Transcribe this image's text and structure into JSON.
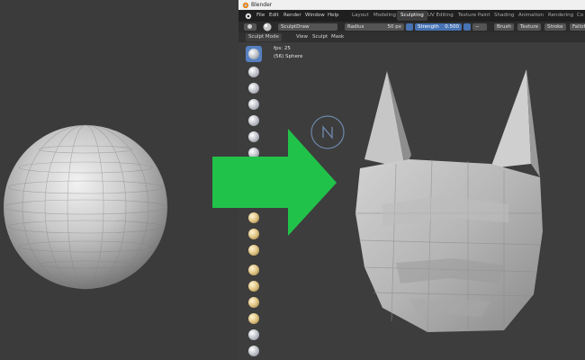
{
  "window": {
    "title": "Blender"
  },
  "menubar": {
    "menus": [
      "File",
      "Edit",
      "Render",
      "Window",
      "Help"
    ],
    "workspaces": [
      "Layout",
      "Modeling",
      "Sculpting",
      "UV Editing",
      "Texture Paint",
      "Shading",
      "Animation",
      "Rendering",
      "Co"
    ],
    "active_workspace": "Sculpting"
  },
  "tool_header": {
    "brush_name": "SculptDraw",
    "radius_label": "Radius",
    "radius_value": "50 px",
    "strength_label": "Strength",
    "strength_value": "0.500",
    "brush_menu": "Brush",
    "texture_menu": "Texture",
    "stroke_menu": "Stroke",
    "falloff_menu": "Falloff"
  },
  "viewport_header": {
    "mode": "Sculpt Mode",
    "menus": [
      "View",
      "Sculpt",
      "Mask"
    ]
  },
  "overlay": {
    "fps": "fps: 25",
    "object": "(56) Sphere"
  },
  "toolbar": {
    "tools": [
      "draw",
      "draw-sharp",
      "clay",
      "clay-strips",
      "layer",
      "inflate",
      "blob",
      "crease",
      "smooth",
      "flatten",
      "fill",
      "scrape",
      "pinch",
      "grab",
      "snake-hook",
      "thumb",
      "pose",
      "nudge",
      "rotate",
      "mask",
      "box-mask"
    ]
  },
  "colors": {
    "arrow": "#21c24a",
    "active_tab": "#3d3d3d",
    "accent_blue": "#4772b3",
    "background": "#3b3b3b"
  }
}
